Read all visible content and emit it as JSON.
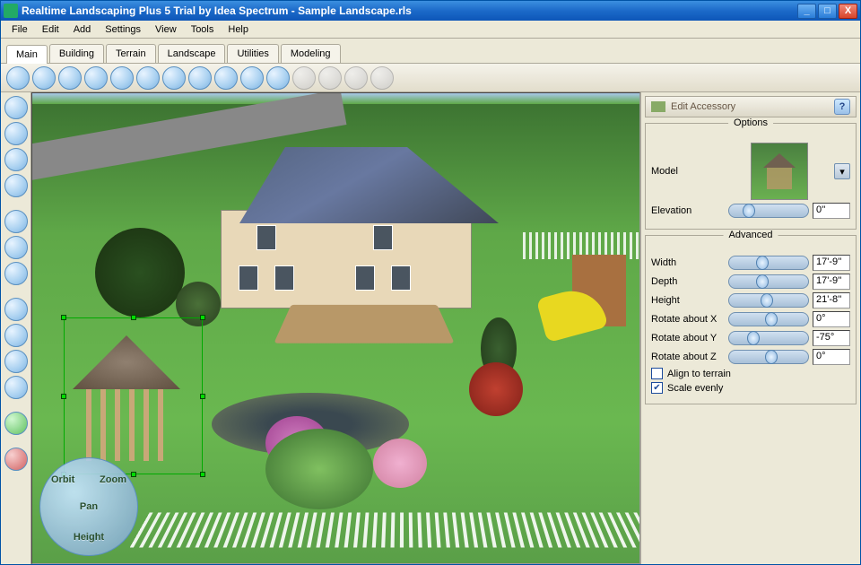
{
  "window": {
    "title": "Realtime Landscaping Plus 5 Trial by Idea Spectrum - Sample Landscape.rls"
  },
  "menu": {
    "items": [
      "File",
      "Edit",
      "Add",
      "Settings",
      "View",
      "Tools",
      "Help"
    ]
  },
  "tabs": {
    "items": [
      "Main",
      "Building",
      "Terrain",
      "Landscape",
      "Utilities",
      "Modeling"
    ],
    "active": 0
  },
  "toolbar": {
    "icons": [
      {
        "name": "undo-icon"
      },
      {
        "name": "redo-icon"
      },
      {
        "name": "open-icon"
      },
      {
        "name": "save-icon"
      },
      {
        "name": "cut-icon"
      },
      {
        "name": "copy-icon"
      },
      {
        "name": "paste-icon"
      },
      {
        "name": "print-icon"
      },
      {
        "name": "pan-icon"
      },
      {
        "name": "brush-icon"
      },
      {
        "name": "mirror-icon"
      },
      {
        "name": "disabled-1",
        "disabled": true
      },
      {
        "name": "disabled-2",
        "disabled": true
      },
      {
        "name": "disabled-3",
        "disabled": true
      },
      {
        "name": "disabled-4",
        "disabled": true
      }
    ]
  },
  "lefttools": {
    "icons": [
      {
        "name": "pointer-tool"
      },
      {
        "name": "orbit-tool"
      },
      {
        "name": "curve-tool"
      },
      {
        "name": "line-tool"
      },
      {
        "name": "spacer",
        "spacer": true
      },
      {
        "name": "rect-tool"
      },
      {
        "name": "circle-tool"
      },
      {
        "name": "shape-tool"
      },
      {
        "name": "spacer",
        "spacer": true
      },
      {
        "name": "hand-tool"
      },
      {
        "name": "zoom-tool"
      },
      {
        "name": "measure-tool"
      },
      {
        "name": "link-tool"
      },
      {
        "name": "spacer",
        "spacer": true
      },
      {
        "name": "green-tool"
      },
      {
        "name": "spacer",
        "spacer": true
      },
      {
        "name": "red-tool"
      }
    ]
  },
  "nav": {
    "orbit": "Orbit",
    "zoom": "Zoom",
    "pan": "Pan",
    "height": "Height"
  },
  "panel": {
    "title": "Edit Accessory",
    "help": "?",
    "options_legend": "Options",
    "advanced_legend": "Advanced",
    "model_label": "Model",
    "elevation": {
      "label": "Elevation",
      "value": "0''"
    },
    "width": {
      "label": "Width",
      "value": "17'-9''"
    },
    "depth": {
      "label": "Depth",
      "value": "17'-9''"
    },
    "height": {
      "label": "Height",
      "value": "21'-8''"
    },
    "rotx": {
      "label": "Rotate about X",
      "value": "0°"
    },
    "roty": {
      "label": "Rotate about Y",
      "value": "-75°"
    },
    "rotz": {
      "label": "Rotate about Z",
      "value": "0°"
    },
    "align": {
      "label": "Align to terrain",
      "checked": false
    },
    "scale": {
      "label": "Scale evenly",
      "checked": true
    }
  }
}
